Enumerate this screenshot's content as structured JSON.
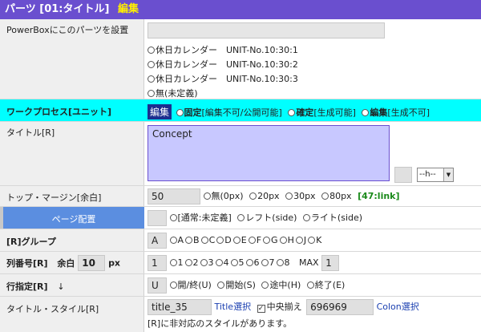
{
  "header": {
    "title": "パーツ [01:タイトル]",
    "edit_label": "編集"
  },
  "powerbox": {
    "label": "PowerBoxにこのパーツを設置",
    "input_value": "",
    "options": [
      "休日カレンダー　UNIT-No.10:30:1",
      "休日カレンダー　UNIT-No.10:30:2",
      "休日カレンダー　UNIT-No.10:30:3",
      "無(未定義)"
    ]
  },
  "workprocess": {
    "label": "ワークプロセス[ユニット]",
    "badge": "編集",
    "opt1_bold": "固定",
    "opt1_rest": "[編集不可/公開可能]",
    "opt2_bold": "確定",
    "opt2_rest": "[生成可能]",
    "opt3_bold": "編集",
    "opt3_rest": "[生成不可]"
  },
  "title": {
    "label": "タイトル[R]",
    "value": "Concept",
    "small_value": "",
    "select_value": "--h--"
  },
  "margin": {
    "label": "トップ・マージン[余白]",
    "value": "50",
    "options": [
      "無(0px)",
      "20px",
      "30px",
      "80px"
    ],
    "link": "[47:link]"
  },
  "page_layout": {
    "label": "ページ配置",
    "value": "",
    "options": [
      "[通常:未定義]",
      "レフト(side)",
      "ライト(side)"
    ]
  },
  "group": {
    "label": "[R]グループ",
    "value": "A",
    "options": [
      "A",
      "B",
      "C",
      "D",
      "E",
      "F",
      "G",
      "H",
      "J",
      "K"
    ]
  },
  "column": {
    "label": "列番号[R]",
    "margin_label": "余白",
    "margin_value": "10",
    "unit": "px",
    "value": "1",
    "options": [
      "1",
      "2",
      "3",
      "4",
      "5",
      "6",
      "7",
      "8"
    ],
    "max_label": "MAX",
    "max_value": "1"
  },
  "line_spec": {
    "label": "行指定[R]",
    "arrow": "↓",
    "value": "U",
    "options": [
      "開/終(U)",
      "開始(S)",
      "途中(H)",
      "終了(E)"
    ]
  },
  "style": {
    "label": "タイトル・スタイル[R]",
    "value": "title_35",
    "select_link": "Title選択",
    "center_label": "中央揃え",
    "center_checked": "✓",
    "color_value": "696969",
    "color_link": "Colon選択",
    "note": "[R]に非対応のスタイルがあります。"
  },
  "colors": {
    "header": "#6a4fcf",
    "cyan": "#00ffff",
    "accent_blue": "#5b8ee0",
    "stripe_orange": "#ff5a00",
    "stripe_red": "#e00000",
    "stripe_cyan": "#00c8e0",
    "stripe_gray": "#c8c8c8"
  }
}
